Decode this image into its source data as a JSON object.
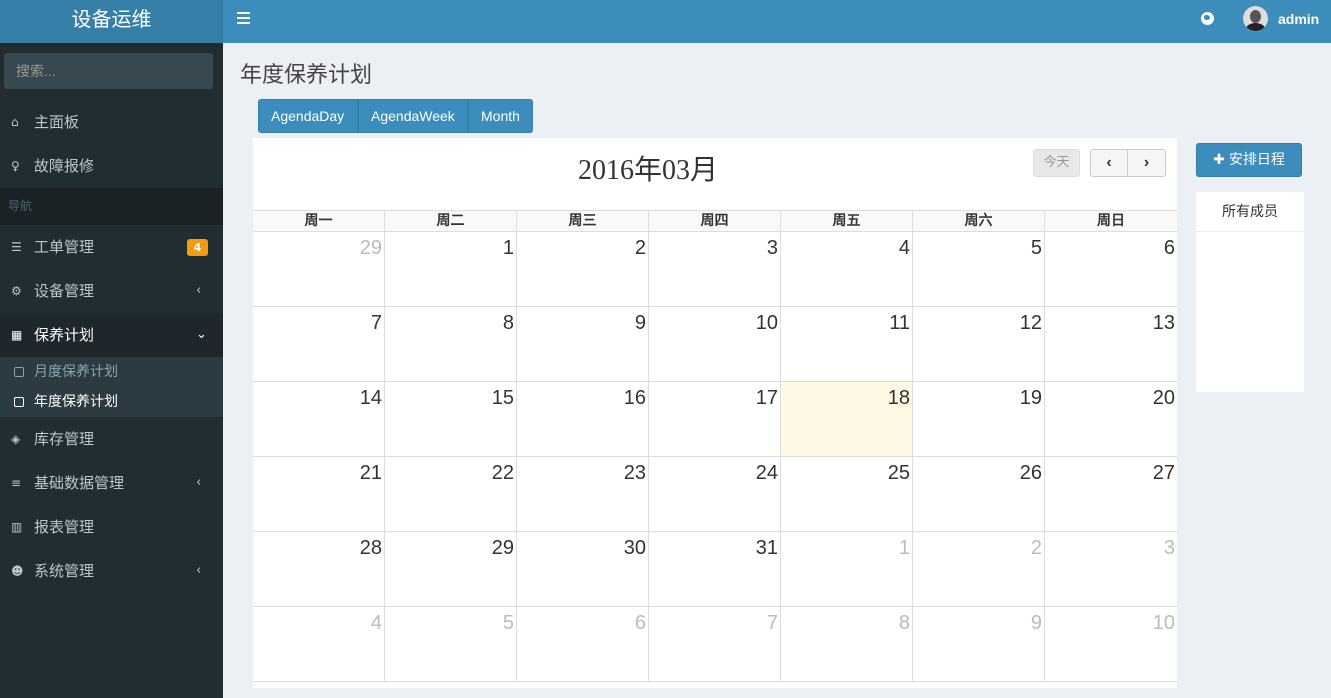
{
  "app": {
    "logo": "设备运维",
    "user": "admin"
  },
  "sidebar": {
    "search_placeholder": "搜索...",
    "items_top": [
      {
        "label": "主面板",
        "icon": "home-icon"
      },
      {
        "label": "故障报修",
        "icon": "lightbulb-icon"
      }
    ],
    "header": "导航",
    "items": [
      {
        "label": "工单管理",
        "icon": "list-icon",
        "badge": "4"
      },
      {
        "label": "设备管理",
        "icon": "gears-icon",
        "chevron": "‹"
      },
      {
        "label": "保养计划",
        "icon": "calendar-icon",
        "chevron": "⌄"
      },
      {
        "label": "库存管理",
        "icon": "cube-icon"
      },
      {
        "label": "基础数据管理",
        "icon": "database-icon",
        "chevron": "‹"
      },
      {
        "label": "报表管理",
        "icon": "bar-chart-icon"
      },
      {
        "label": "系统管理",
        "icon": "users-icon",
        "chevron": "‹"
      }
    ],
    "subitems": [
      {
        "label": "月度保养计划"
      },
      {
        "label": "年度保养计划"
      }
    ]
  },
  "page": {
    "title": "年度保养计划"
  },
  "views": {
    "day": "AgendaDay",
    "week": "AgendaWeek",
    "month": "Month"
  },
  "calendar": {
    "title": "2016年03月",
    "today_label": "今天",
    "prev": "‹",
    "next": "›",
    "weekdays": [
      "周一",
      "周二",
      "周三",
      "周四",
      "周五",
      "周六",
      "周日"
    ],
    "weeks": [
      [
        "29",
        "1",
        "2",
        "3",
        "4",
        "5",
        "6"
      ],
      [
        "7",
        "8",
        "9",
        "10",
        "11",
        "12",
        "13"
      ],
      [
        "14",
        "15",
        "16",
        "17",
        "18",
        "19",
        "20"
      ],
      [
        "21",
        "22",
        "23",
        "24",
        "25",
        "26",
        "27"
      ],
      [
        "28",
        "29",
        "30",
        "31",
        "1",
        "2",
        "3"
      ],
      [
        "4",
        "5",
        "6",
        "7",
        "8",
        "9",
        "10"
      ]
    ]
  },
  "panel": {
    "add_label": "安排日程",
    "members_title": "所有成员"
  }
}
